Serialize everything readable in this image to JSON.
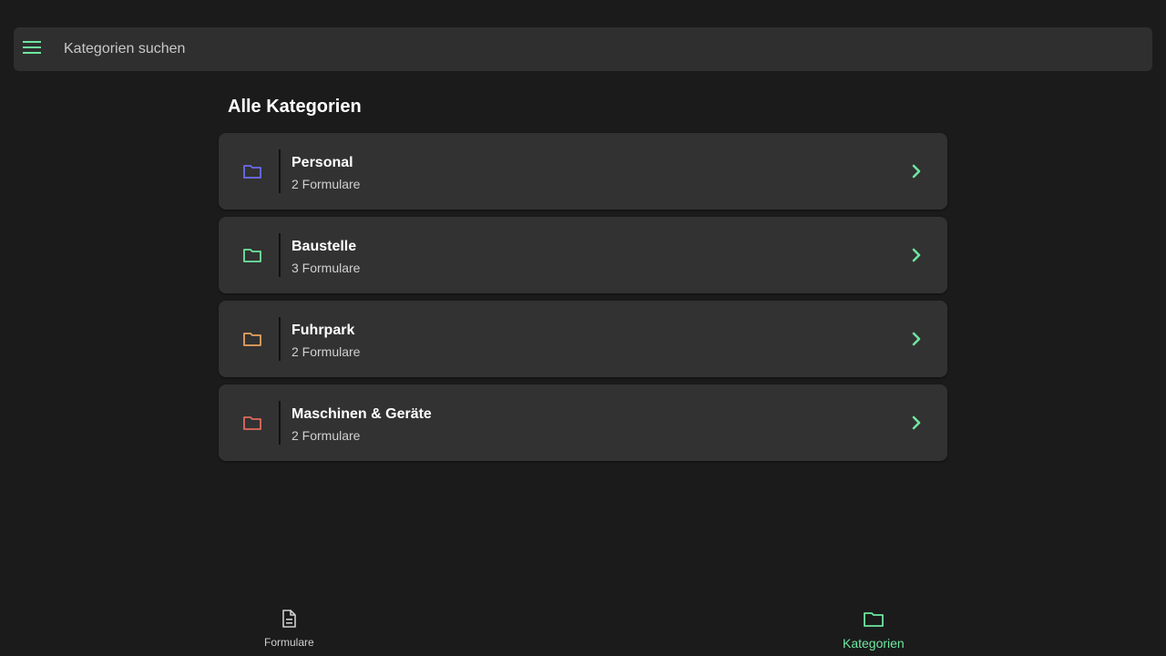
{
  "search": {
    "placeholder": "Kategorien suchen",
    "value": ""
  },
  "icons": {
    "menu": "menu-icon",
    "folder": "folder-icon",
    "chevron": "chevron-right-icon",
    "document": "document-icon"
  },
  "colors": {
    "accent": "#6ee7a0",
    "background": "#1b1b1b",
    "card": "#323232"
  },
  "main": {
    "title": "Alle Kategorien",
    "categories": [
      {
        "name": "Personal",
        "count": "2 Formulare",
        "color": "#6b6bf0"
      },
      {
        "name": "Baustelle",
        "count": "3 Formulare",
        "color": "#6ee7a0"
      },
      {
        "name": "Fuhrpark",
        "count": "2 Formulare",
        "color": "#e8a25e"
      },
      {
        "name": "Maschinen & Geräte",
        "count": "2 Formulare",
        "color": "#e06a5e"
      }
    ]
  },
  "bottom_nav": {
    "items": [
      {
        "label": "Formulare",
        "icon": "document-icon",
        "active": false
      },
      {
        "label": "Kategorien",
        "icon": "folder-icon",
        "active": true
      }
    ]
  }
}
